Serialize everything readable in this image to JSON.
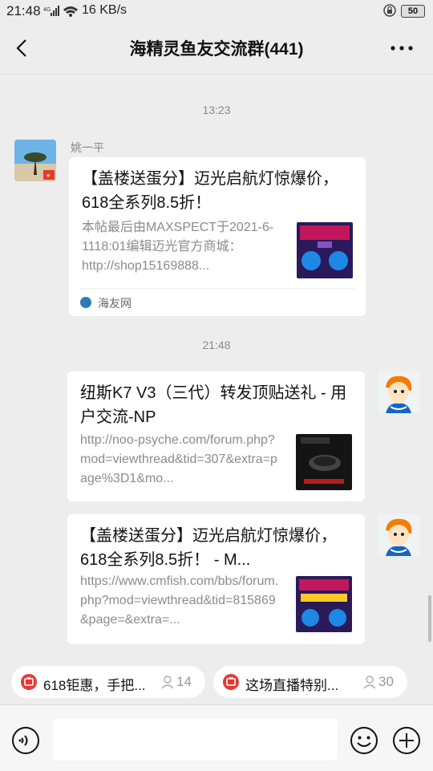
{
  "status_bar": {
    "time": "21:48",
    "network": "4G",
    "speed": "16 KB/s",
    "battery": "50"
  },
  "header": {
    "title": "海精灵鱼友交流群(441)"
  },
  "messages": [
    {
      "timestamp": "13:23",
      "sender": "姚一平",
      "title": "【盖楼送蛋分】迈光启航灯惊爆价，618全系列8.5折！",
      "desc": "本帖最后由MAXSPECT于2021-6-1118:01编辑迈光官方商城：http://shop15169888...",
      "source": "海友网"
    },
    {
      "timestamp": "21:48",
      "title": "纽斯K7 V3（三代）转发顶贴送礼 - 用户交流-NP",
      "desc": "http://noo-psyche.com/forum.php?mod=viewthread&tid=307&extra=page%3D1&mo..."
    },
    {
      "title": "【盖楼送蛋分】迈光启航灯惊爆价，618全系列8.5折！ - M...",
      "desc": "https://www.cmfish.com/bbs/forum.php?mod=viewthread&tid=815869&page=&extra=..."
    }
  ],
  "live_pills": [
    {
      "text": "618钜惠，手把...",
      "count": "14"
    },
    {
      "text": "这场直播特别...",
      "count": "30"
    }
  ],
  "colors": {
    "background": "#ededed",
    "card": "#ffffff",
    "live_red": "#e53935"
  }
}
